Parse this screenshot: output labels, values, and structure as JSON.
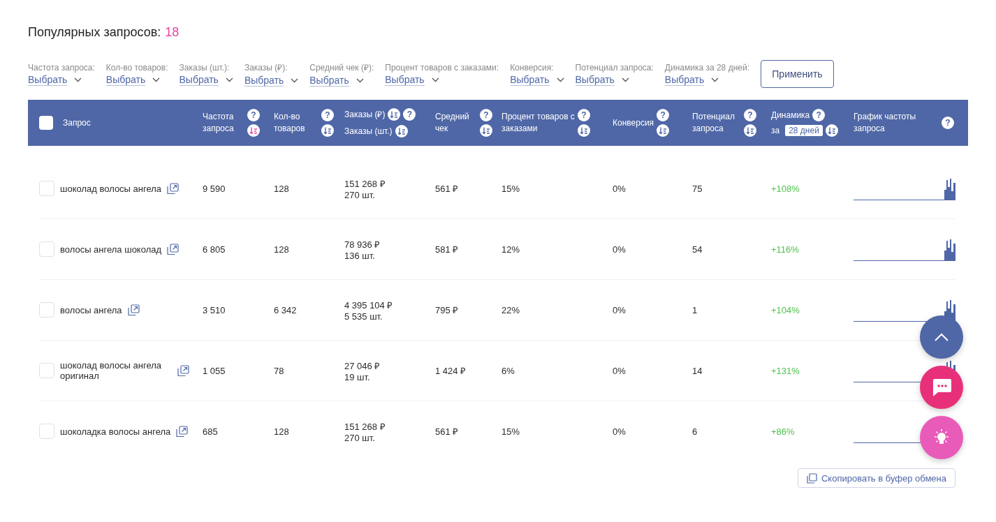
{
  "title": {
    "label": "Популярных запросов:",
    "count": "18"
  },
  "filters": [
    {
      "label": "Частота запроса:",
      "value": "Выбрать"
    },
    {
      "label": "Кол-во товаров:",
      "value": "Выбрать"
    },
    {
      "label": "Заказы (шт.):",
      "value": "Выбрать"
    },
    {
      "label": "Заказы (₽):",
      "value": "Выбрать"
    },
    {
      "label": "Средний чек (₽):",
      "value": "Выбрать"
    },
    {
      "label": "Процент товаров с заказами:",
      "value": "Выбрать"
    },
    {
      "label": "Конверсия:",
      "value": "Выбрать"
    },
    {
      "label": "Потенциал запроса:",
      "value": "Выбрать"
    },
    {
      "label": "Динамика за 28 дней:",
      "value": "Выбрать"
    }
  ],
  "apply_button": "Применить",
  "header": {
    "select_all_checked": false,
    "columns": [
      {
        "kind": "query",
        "label": "Запрос"
      },
      {
        "kind": "sortable",
        "label": "Частота запроса",
        "help": "?",
        "sort_active": true
      },
      {
        "kind": "sortable",
        "label": "Кол-во товаров",
        "help": "?",
        "sort_active": false
      },
      {
        "kind": "double",
        "label": "Заказы (₽)",
        "label_2": "Заказы (шт.)",
        "help": "?",
        "sort_active": false
      },
      {
        "kind": "sortable",
        "label": "Средний чек",
        "help": "?",
        "sort_active": false
      },
      {
        "kind": "sortable",
        "label": "Процент товаров с заказами",
        "help": "?",
        "sort_active": false
      },
      {
        "kind": "sortable",
        "label": "Конверсия",
        "help": "?",
        "sort_active": false
      },
      {
        "kind": "sortable",
        "label": "Потенциал запроса",
        "help": "?",
        "sort_active": false
      },
      {
        "kind": "period",
        "label": "Динамика",
        "prefix": "за",
        "period": "28 дней",
        "help": "?",
        "sort_active": false
      },
      {
        "kind": "plain",
        "label": "График частоты запроса",
        "help": "?"
      }
    ]
  },
  "rows": [
    {
      "checked": false,
      "query": "шоколад волосы ангела",
      "frequency": "9 590",
      "products": "128",
      "orders_rub": "151 268 ₽",
      "orders_pcs": "270 шт.",
      "avg_check": "561 ₽",
      "percent": "15%",
      "conversion": "0%",
      "potential": "75",
      "dynamics": "+108%"
    },
    {
      "checked": false,
      "query": "волосы ангела шоколад",
      "frequency": "6 805",
      "products": "128",
      "orders_rub": "78 936 ₽",
      "orders_pcs": "136 шт.",
      "avg_check": "581 ₽",
      "percent": "12%",
      "conversion": "0%",
      "potential": "54",
      "dynamics": "+116%"
    },
    {
      "checked": false,
      "query": "волосы ангела",
      "frequency": "3 510",
      "products": "6 342",
      "orders_rub": "4 395 104 ₽",
      "orders_pcs": "5 535 шт.",
      "avg_check": "795 ₽",
      "percent": "22%",
      "conversion": "0%",
      "potential": "1",
      "dynamics": "+104%"
    },
    {
      "checked": false,
      "query": "шоколад волосы ангела оригинал",
      "frequency": "1 055",
      "products": "78",
      "orders_rub": "27 046 ₽",
      "orders_pcs": "19 шт.",
      "avg_check": "1 424 ₽",
      "percent": "6%",
      "conversion": "0%",
      "potential": "14",
      "dynamics": "+131%"
    },
    {
      "checked": false,
      "query": "шоколадка волосы ангела",
      "frequency": "685",
      "products": "128",
      "orders_rub": "151 268 ₽",
      "orders_pcs": "270 шт.",
      "avg_check": "561 ₽",
      "percent": "15%",
      "conversion": "0%",
      "potential": "6",
      "dynamics": "+86%"
    }
  ],
  "copy_button": "Скопировать в буфер обмена"
}
